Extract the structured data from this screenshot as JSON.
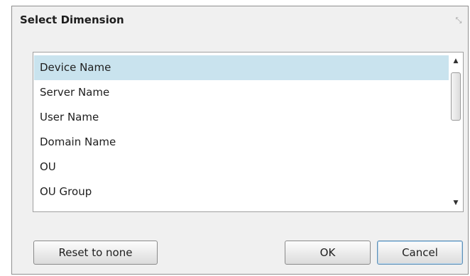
{
  "dialog": {
    "title": "Select Dimension",
    "close_glyph": "⤡"
  },
  "list": {
    "items": [
      {
        "label": "Device Name",
        "selected": true
      },
      {
        "label": "Server Name",
        "selected": false
      },
      {
        "label": "User Name",
        "selected": false
      },
      {
        "label": "Domain Name",
        "selected": false
      },
      {
        "label": "OU",
        "selected": false
      },
      {
        "label": "OU Group",
        "selected": false
      }
    ],
    "scroll_up_glyph": "▲",
    "scroll_down_glyph": "▼"
  },
  "buttons": {
    "reset_label": "Reset to none",
    "ok_label": "OK",
    "cancel_label": "Cancel"
  },
  "colors": {
    "selected_row": "#c9e3ee",
    "dialog_background": "#f0f0f0"
  }
}
